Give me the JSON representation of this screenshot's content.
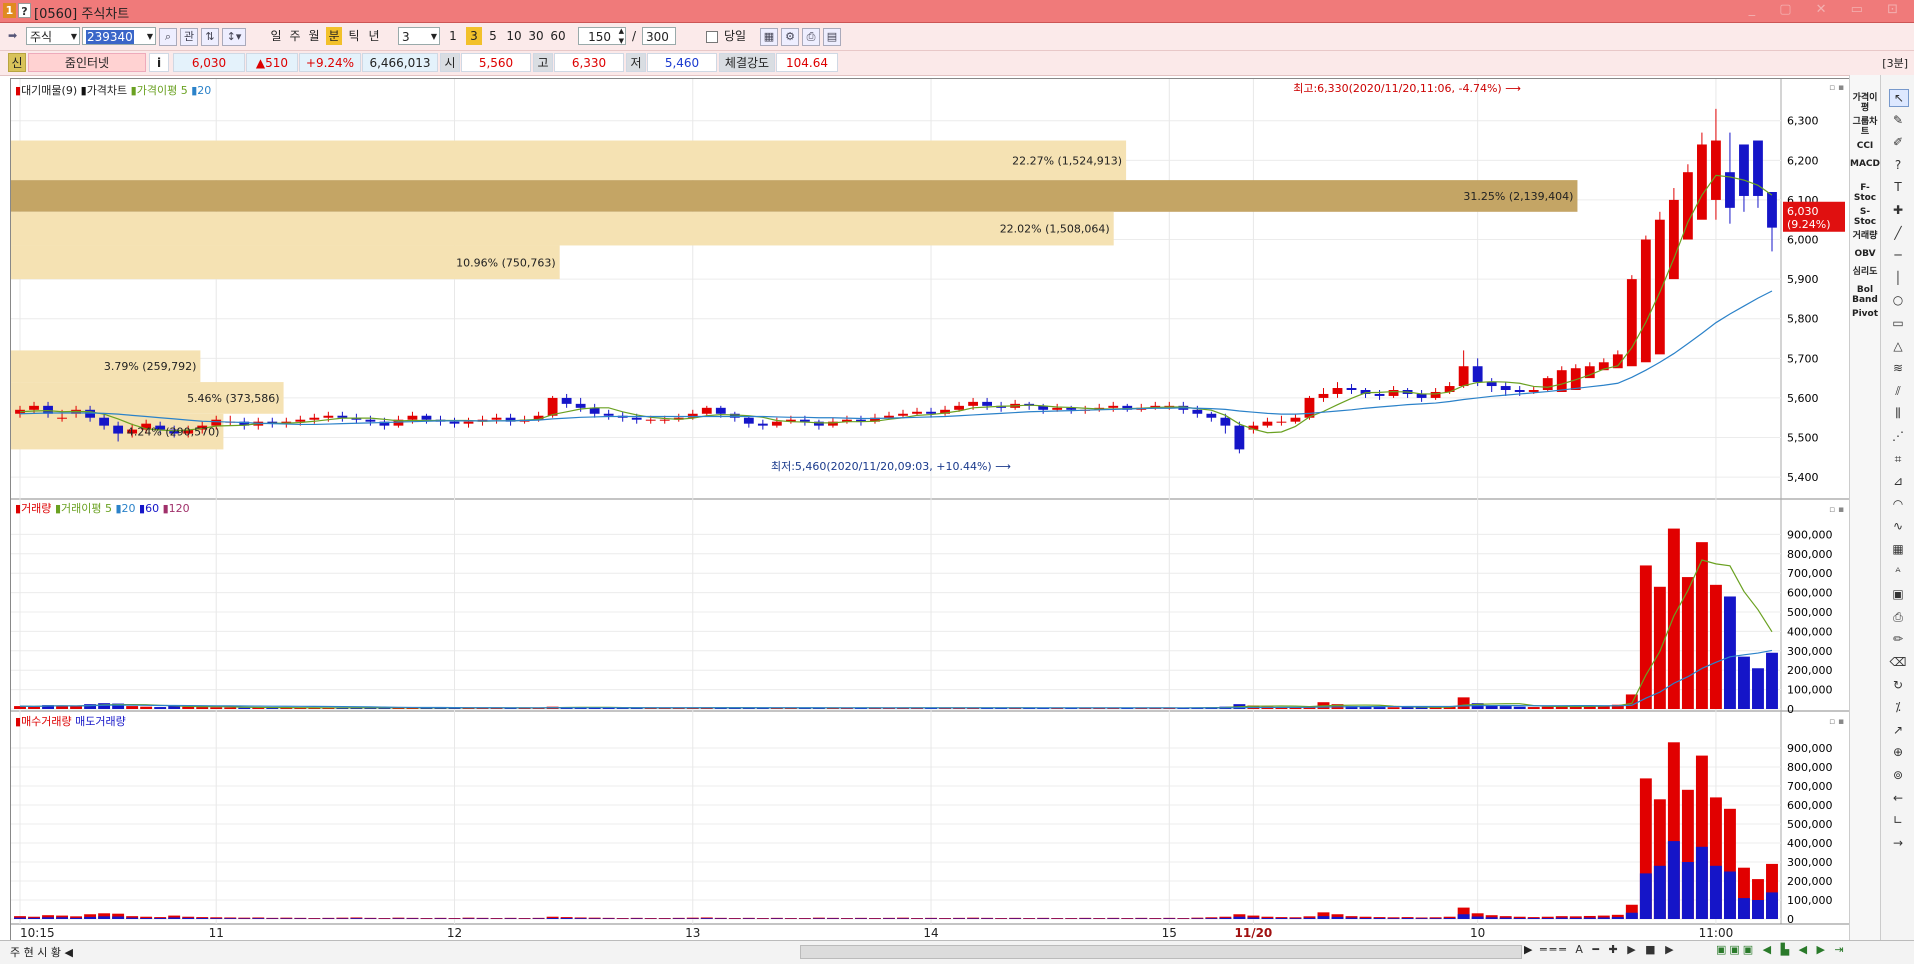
{
  "window": {
    "title": "[0560] 주식차트",
    "badge1": "1",
    "badge2": "?",
    "controls": "_ ▢ ✕ ▭ ⊡"
  },
  "toolbar": {
    "market": "주식",
    "code": "239340",
    "btn_gwan": "관",
    "periods": [
      "일",
      "주",
      "월",
      "분",
      "틱",
      "년"
    ],
    "period_active": "분",
    "interval_value": "3",
    "minute_buttons": [
      "1",
      "3",
      "5",
      "10",
      "30",
      "60"
    ],
    "minute_active": "3",
    "count_value": "150",
    "total_value": "300",
    "slash": "/",
    "today_label": "당일"
  },
  "info": {
    "credit_badge": "신",
    "name": "줌인터넷",
    "info_btn": "i",
    "price": "6,030",
    "change": "▲510",
    "change_pct": "+9.24%",
    "volume": "6,466,013",
    "open_label": "시",
    "open": "5,560",
    "high_label": "고",
    "high": "6,330",
    "low_label": "저",
    "low": "5,460",
    "strength_label": "체결강도",
    "strength": "104.64",
    "period_badge": "[3분]"
  },
  "legend1": {
    "vp": "대기매물(9)",
    "price": "가격차트",
    "ma": "가격이평",
    "ma5": "5",
    "ma20": "20"
  },
  "legend2": {
    "vol": "거래량",
    "vma": "거래이평",
    "v5": "5",
    "v20": "20",
    "v60": "60",
    "v120": "120"
  },
  "legend3": {
    "buy": "매수거래량",
    "sell": "매도거래량"
  },
  "annotations": {
    "high": "최고:6,330(2020/11/20,11:06, -4.74%)",
    "low": "최저:5,460(2020/11/20,09:03, +10.44%)"
  },
  "current_price_tag": {
    "price": "6,030",
    "pct": "(9.24%)"
  },
  "volume_profile": [
    {
      "label": "22.27% (1,524,913)",
      "lo": 6150,
      "hi": 6250,
      "frac": 0.63,
      "dark": false
    },
    {
      "label": "31.25% (2,139,404)",
      "lo": 6070,
      "hi": 6150,
      "frac": 0.885,
      "dark": true
    },
    {
      "label": "22.02% (1,508,064)",
      "lo": 5985,
      "hi": 6070,
      "frac": 0.623,
      "dark": false
    },
    {
      "label": "10.96% (750,763)",
      "lo": 5900,
      "hi": 5985,
      "frac": 0.31,
      "dark": false
    },
    {
      "label": "3.79% (259,792)",
      "lo": 5640,
      "hi": 5720,
      "frac": 0.107,
      "dark": false
    },
    {
      "label": "5.46% (373,586)",
      "lo": 5560,
      "hi": 5640,
      "frac": 0.154,
      "dark": false
    },
    {
      "label": "4.24% (290,570)",
      "lo": 5470,
      "hi": 5560,
      "frac": 0.12,
      "dark": false
    }
  ],
  "chart_data": {
    "type": "candlestick",
    "price_axis": {
      "min": 5370,
      "max": 6370,
      "ticks": [
        5400,
        5500,
        5600,
        5700,
        5800,
        5900,
        6000,
        6100,
        6200,
        6300
      ],
      "tick_labels": [
        "5,400",
        "5,500",
        "5,600",
        "5,700",
        "5,800",
        "5,900",
        "6,000",
        "6,100",
        "6,200",
        "6,300"
      ]
    },
    "volume_axis": {
      "min": 0,
      "max": 1000000,
      "ticks": [
        0,
        100000,
        200000,
        300000,
        400000,
        500000,
        600000,
        700000,
        800000,
        900000
      ],
      "tick_labels": [
        "0",
        "100,000",
        "200,000",
        "300,000",
        "400,000",
        "500,000",
        "600,000",
        "700,000",
        "800,000",
        "900,000"
      ]
    },
    "x_labels": [
      {
        "i": 0,
        "text": "10:15",
        "bold": false
      },
      {
        "i": 14,
        "text": "11",
        "bold": false
      },
      {
        "i": 31,
        "text": "12",
        "bold": false
      },
      {
        "i": 48,
        "text": "13",
        "bold": false
      },
      {
        "i": 65,
        "text": "14",
        "bold": false
      },
      {
        "i": 82,
        "text": "15",
        "bold": false
      },
      {
        "i": 88,
        "text": "11/20",
        "bold": true
      },
      {
        "i": 104,
        "text": "10",
        "bold": false
      },
      {
        "i": 121,
        "text": "11:00",
        "bold": false
      }
    ],
    "series_names": [
      "MA5",
      "MA20"
    ],
    "candles": [],
    "last_bars_note": "",
    "open": [
      5560,
      5570,
      5580,
      5550,
      5560,
      5570,
      5550,
      5530,
      5510,
      5520,
      5530,
      5520,
      5510,
      5520,
      5530,
      5540,
      5540,
      5530,
      5540,
      5535,
      5540,
      5545,
      5550,
      5555,
      5550,
      5545,
      5540,
      5530,
      5545,
      5555,
      5545,
      5540,
      5535,
      5540,
      5545,
      5550,
      5540,
      5545,
      5555,
      5600,
      5585,
      5575,
      5560,
      5555,
      5550,
      5545,
      5545,
      5545,
      5550,
      5560,
      5575,
      5560,
      5550,
      5535,
      5530,
      5540,
      5545,
      5540,
      5530,
      5540,
      5545,
      5540,
      5550,
      5555,
      5560,
      5565,
      5560,
      5570,
      5580,
      5590,
      5580,
      5575,
      5585,
      5580,
      5570,
      5575,
      5570,
      5570,
      5575,
      5580,
      5570,
      5575,
      5580,
      5580,
      5570,
      5560,
      5550,
      5530,
      5520,
      5530,
      5540,
      5540,
      5550,
      5600,
      5610,
      5625,
      5620,
      5610,
      5605,
      5620,
      5610,
      5600,
      5615,
      5630,
      5680,
      5640,
      5630,
      5620,
      5615,
      5620,
      5615,
      5620,
      5650,
      5670,
      5675,
      5680,
      5690,
      5710,
      5900,
      6000,
      6050,
      6100,
      6170,
      6240,
      6250,
      6120,
      6100,
      6110
    ],
    "close": [
      5570,
      5580,
      5560,
      5550,
      5570,
      5550,
      5530,
      5510,
      5520,
      5535,
      5520,
      5510,
      5520,
      5530,
      5545,
      5540,
      5530,
      5540,
      5535,
      5540,
      5545,
      5550,
      5555,
      5550,
      5545,
      5540,
      5530,
      5545,
      5555,
      5545,
      5540,
      5535,
      5540,
      5545,
      5550,
      5540,
      5545,
      5555,
      5600,
      5585,
      5575,
      5560,
      5555,
      5550,
      5545,
      5545,
      5545,
      5550,
      5560,
      5575,
      5560,
      5550,
      5535,
      5530,
      5540,
      5545,
      5540,
      5530,
      5540,
      5545,
      5540,
      5550,
      5555,
      5560,
      5565,
      5560,
      5570,
      5580,
      5590,
      5580,
      5575,
      5585,
      5580,
      5570,
      5575,
      5570,
      5570,
      5575,
      5580,
      5570,
      5575,
      5580,
      5580,
      5570,
      5560,
      5550,
      5530,
      5470,
      5530,
      5540,
      5540,
      5550,
      5600,
      5610,
      5625,
      5620,
      5610,
      5605,
      5620,
      5610,
      5600,
      5615,
      5630,
      5680,
      5640,
      5630,
      5620,
      5615,
      5620,
      5650,
      5670,
      5675,
      5680,
      5690,
      5710,
      5900,
      6000,
      6050,
      6100,
      6170,
      6240,
      6250,
      6080,
      6110,
      6110,
      6030
    ],
    "high": [
      5580,
      5590,
      5590,
      5570,
      5580,
      5580,
      5560,
      5540,
      5535,
      5545,
      5540,
      5530,
      5530,
      5540,
      5555,
      5555,
      5550,
      5550,
      5550,
      5550,
      5555,
      5560,
      5565,
      5565,
      5560,
      5555,
      5550,
      5555,
      5565,
      5560,
      5555,
      5550,
      5550,
      5555,
      5560,
      5560,
      5555,
      5565,
      5605,
      5610,
      5600,
      5585,
      5570,
      5565,
      5560,
      5555,
      5555,
      5560,
      5570,
      5580,
      5580,
      5565,
      5555,
      5545,
      5550,
      5555,
      5555,
      5545,
      5550,
      5555,
      5555,
      5560,
      5565,
      5570,
      5575,
      5575,
      5580,
      5590,
      5600,
      5600,
      5590,
      5595,
      5590,
      5585,
      5585,
      5580,
      5580,
      5585,
      5590,
      5585,
      5585,
      5590,
      5590,
      5590,
      5580,
      5565,
      5560,
      5540,
      5540,
      5550,
      5555,
      5560,
      5605,
      5625,
      5640,
      5635,
      5625,
      5620,
      5630,
      5625,
      5620,
      5625,
      5640,
      5720,
      5700,
      5650,
      5640,
      5630,
      5630,
      5655,
      5680,
      5685,
      5690,
      5700,
      5720,
      5910,
      6010,
      6070,
      6130,
      6190,
      6270,
      6330,
      6270,
      6140,
      6190,
      6120
    ],
    "low": [
      5550,
      5560,
      5550,
      5540,
      5550,
      5540,
      5520,
      5490,
      5500,
      5510,
      5510,
      5500,
      5500,
      5510,
      5520,
      5530,
      5520,
      5520,
      5525,
      5525,
      5530,
      5535,
      5540,
      5540,
      5535,
      5530,
      5520,
      5525,
      5535,
      5535,
      5530,
      5525,
      5525,
      5530,
      5535,
      5530,
      5535,
      5540,
      5550,
      5575,
      5565,
      5550,
      5545,
      5540,
      5535,
      5535,
      5535,
      5540,
      5545,
      5555,
      5550,
      5540,
      5525,
      5520,
      5525,
      5535,
      5530,
      5520,
      5525,
      5535,
      5530,
      5535,
      5545,
      5550,
      5555,
      5550,
      5555,
      5565,
      5570,
      5570,
      5565,
      5570,
      5570,
      5560,
      5565,
      5560,
      5560,
      5565,
      5565,
      5565,
      5565,
      5570,
      5570,
      5560,
      5550,
      5540,
      5510,
      5460,
      5510,
      5525,
      5530,
      5535,
      5545,
      5590,
      5600,
      5610,
      5600,
      5595,
      5600,
      5600,
      5590,
      5595,
      5610,
      5625,
      5630,
      5615,
      5605,
      5605,
      5610,
      5615,
      5645,
      5660,
      5665,
      5675,
      5685,
      5700,
      5880,
      5980,
      6030,
      6080,
      6150,
      6050,
      6040,
      6070,
      6080,
      5970
    ],
    "ma5": [
      5565,
      5567,
      5568,
      5565,
      5566,
      5565,
      5559,
      5547,
      5533,
      5522,
      5519,
      5517,
      5519,
      5523,
      5529,
      5530,
      5531,
      5535,
      5536,
      5536,
      5538,
      5541,
      5545,
      5549,
      5549,
      5549,
      5546,
      5542,
      5543,
      5543,
      5543,
      5543,
      5543,
      5541,
      5542,
      5542,
      5544,
      5546,
      5558,
      5565,
      5572,
      5575,
      5575,
      5565,
      5557,
      5551,
      5548,
      5546,
      5549,
      5555,
      5558,
      5557,
      5555,
      5551,
      5543,
      5540,
      5539,
      5537,
      5537,
      5540,
      5540,
      5541,
      5546,
      5550,
      5556,
      5558,
      5562,
      5567,
      5575,
      5577,
      5579,
      5580,
      5582,
      5580,
      5577,
      5576,
      5574,
      5572,
      5572,
      5573,
      5574,
      5576,
      5577,
      5577,
      5573,
      5569,
      5556,
      5534,
      5521,
      5512,
      5514,
      5528,
      5552,
      5566,
      5583,
      5599,
      5613,
      5614,
      5616,
      5615,
      5610,
      5610,
      5615,
      5631,
      5639,
      5641,
      5640,
      5637,
      5629,
      5627,
      5635,
      5646,
      5658,
      5673,
      5681,
      5727,
      5791,
      5867,
      5952,
      6044,
      6112,
      6162,
      6158,
      6150,
      6137,
      6112
    ],
    "ma20": [
      5560,
      5561,
      5562,
      5562,
      5562,
      5562,
      5561,
      5559,
      5556,
      5553,
      5550,
      5547,
      5544,
      5541,
      5540,
      5539,
      5538,
      5536,
      5535,
      5534,
      5533,
      5533,
      5534,
      5535,
      5536,
      5537,
      5538,
      5539,
      5540,
      5541,
      5542,
      5542,
      5542,
      5542,
      5542,
      5542,
      5543,
      5544,
      5547,
      5549,
      5551,
      5552,
      5553,
      5553,
      5553,
      5553,
      5553,
      5553,
      5553,
      5553,
      5553,
      5553,
      5553,
      5553,
      5552,
      5551,
      5551,
      5550,
      5550,
      5549,
      5548,
      5548,
      5549,
      5550,
      5551,
      5552,
      5553,
      5555,
      5557,
      5559,
      5561,
      5563,
      5565,
      5566,
      5567,
      5568,
      5569,
      5570,
      5571,
      5572,
      5573,
      5574,
      5574,
      5575,
      5574,
      5573,
      5571,
      5567,
      5564,
      5561,
      5559,
      5559,
      5561,
      5564,
      5567,
      5570,
      5574,
      5577,
      5580,
      5583,
      5585,
      5587,
      5591,
      5596,
      5600,
      5604,
      5607,
      5610,
      5613,
      5616,
      5620,
      5624,
      5628,
      5632,
      5637,
      5652,
      5670,
      5690,
      5712,
      5737,
      5763,
      5790,
      5812,
      5832,
      5852,
      5870
    ],
    "volume": [
      15000,
      12000,
      20000,
      18000,
      14000,
      25000,
      30000,
      28000,
      15000,
      12000,
      10000,
      18000,
      12000,
      10000,
      9000,
      8000,
      7000,
      8000,
      6000,
      7000,
      6000,
      5000,
      6000,
      7000,
      8000,
      6000,
      5000,
      7000,
      6000,
      5000,
      6000,
      5000,
      7000,
      6000,
      5000,
      6000,
      5000,
      6000,
      12000,
      10000,
      8000,
      7000,
      6000,
      5000,
      6000,
      5000,
      5000,
      6000,
      7000,
      8000,
      6000,
      5000,
      6000,
      5000,
      6000,
      5000,
      5000,
      7000,
      6000,
      5000,
      6000,
      5000,
      6000,
      7000,
      5000,
      6000,
      5000,
      6000,
      7000,
      6000,
      5000,
      6000,
      5000,
      6000,
      5000,
      5000,
      6000,
      5000,
      6000,
      5000,
      6000,
      5000,
      6000,
      5000,
      7000,
      9000,
      12000,
      25000,
      18000,
      12000,
      10000,
      9000,
      14000,
      35000,
      25000,
      15000,
      12000,
      10000,
      9000,
      10000,
      8000,
      9000,
      12000,
      60000,
      30000,
      20000,
      15000,
      12000,
      10000,
      12000,
      15000,
      14000,
      16000,
      18000,
      22000,
      75000,
      740000,
      630000,
      930000,
      680000,
      860000,
      640000,
      580000,
      270000,
      210000,
      290000
    ],
    "buy_volume": [
      8000,
      6000,
      11000,
      9000,
      8000,
      14000,
      16000,
      15000,
      8000,
      7000,
      5000,
      10000,
      6000,
      5000,
      5000,
      4000,
      4000,
      4000,
      3000,
      4000,
      3000,
      3000,
      3000,
      4000,
      4000,
      3000,
      3000,
      4000,
      3000,
      3000,
      3000,
      3000,
      4000,
      3000,
      3000,
      3000,
      3000,
      3000,
      7000,
      5000,
      4000,
      4000,
      3000,
      3000,
      3000,
      3000,
      3000,
      3000,
      4000,
      4000,
      3000,
      3000,
      3000,
      3000,
      3000,
      3000,
      3000,
      4000,
      3000,
      3000,
      3000,
      3000,
      3000,
      4000,
      3000,
      3000,
      3000,
      3000,
      4000,
      3000,
      3000,
      3000,
      3000,
      3000,
      3000,
      3000,
      3000,
      3000,
      3000,
      3000,
      3000,
      3000,
      3000,
      3000,
      4000,
      5000,
      6000,
      13000,
      10000,
      7000,
      5000,
      5000,
      8000,
      20000,
      14000,
      8000,
      7000,
      5000,
      5000,
      5000,
      4000,
      5000,
      7000,
      35000,
      17000,
      11000,
      8000,
      7000,
      5000,
      7000,
      8000,
      8000,
      9000,
      10000,
      12000,
      42000,
      500000,
      350000,
      520000,
      380000,
      480000,
      360000,
      330000,
      160000,
      110000,
      150000
    ],
    "sell_volume": [
      7000,
      6000,
      9000,
      9000,
      6000,
      11000,
      14000,
      13000,
      7000,
      5000,
      5000,
      8000,
      6000,
      5000,
      4000,
      4000,
      3000,
      4000,
      3000,
      3000,
      3000,
      2000,
      3000,
      3000,
      4000,
      3000,
      2000,
      3000,
      3000,
      2000,
      3000,
      2000,
      3000,
      3000,
      2000,
      3000,
      2000,
      3000,
      5000,
      5000,
      4000,
      3000,
      3000,
      2000,
      3000,
      2000,
      2000,
      3000,
      3000,
      4000,
      3000,
      2000,
      3000,
      2000,
      3000,
      2000,
      2000,
      3000,
      3000,
      2000,
      3000,
      2000,
      3000,
      3000,
      2000,
      3000,
      2000,
      3000,
      3000,
      3000,
      2000,
      3000,
      2000,
      3000,
      2000,
      2000,
      3000,
      2000,
      3000,
      2000,
      3000,
      2000,
      3000,
      2000,
      3000,
      4000,
      6000,
      12000,
      8000,
      5000,
      5000,
      4000,
      6000,
      15000,
      11000,
      7000,
      5000,
      5000,
      4000,
      5000,
      4000,
      4000,
      5000,
      25000,
      13000,
      9000,
      7000,
      5000,
      5000,
      5000,
      7000,
      6000,
      7000,
      8000,
      10000,
      33000,
      240000,
      280000,
      410000,
      300000,
      380000,
      280000,
      250000,
      110000,
      100000,
      140000
    ],
    "vma5": [],
    "vma20": []
  },
  "right_tools1": [
    "가격이평",
    "그룹차트",
    "CCI",
    "MACD",
    "F-Stoc",
    "S-Stoc",
    "거래량",
    "OBV",
    "심리도",
    "Bol Band",
    "Pivot"
  ],
  "right_tools2_icons": [
    "cursor-icon",
    "eraser-icon",
    "brush-icon",
    "help-icon",
    "text-icon",
    "cross-icon",
    "line-icon",
    "hline-icon",
    "vline-icon",
    "circle-icon",
    "rect-icon",
    "triangle-icon",
    "fib-icon",
    "channel-icon",
    "andrews-icon",
    "gann-icon",
    "speed-icon",
    "fan-icon",
    "arc-icon",
    "wave-icon",
    "grid-icon",
    "auto-icon",
    "save-icon",
    "print-icon",
    "draw-icon",
    "erase2-icon",
    "cycle-icon",
    "ratio-icon",
    "arrow-icon",
    "zoom-icon",
    "mag-icon",
    "back-icon",
    "corner-icon",
    "right-icon"
  ],
  "bottom": {
    "tabs": [
      "주",
      "현",
      "시",
      "황"
    ],
    "arrow_left": "◀",
    "arrow_right": "▶"
  },
  "colors": {
    "up": "#e10000",
    "down": "#1515c8",
    "ma5": "#6aa121",
    "ma20": "#2b82c9",
    "vp_light": "#f5e2b3",
    "vp_dark": "#c4a565",
    "title_bg": "#f07a7a"
  }
}
